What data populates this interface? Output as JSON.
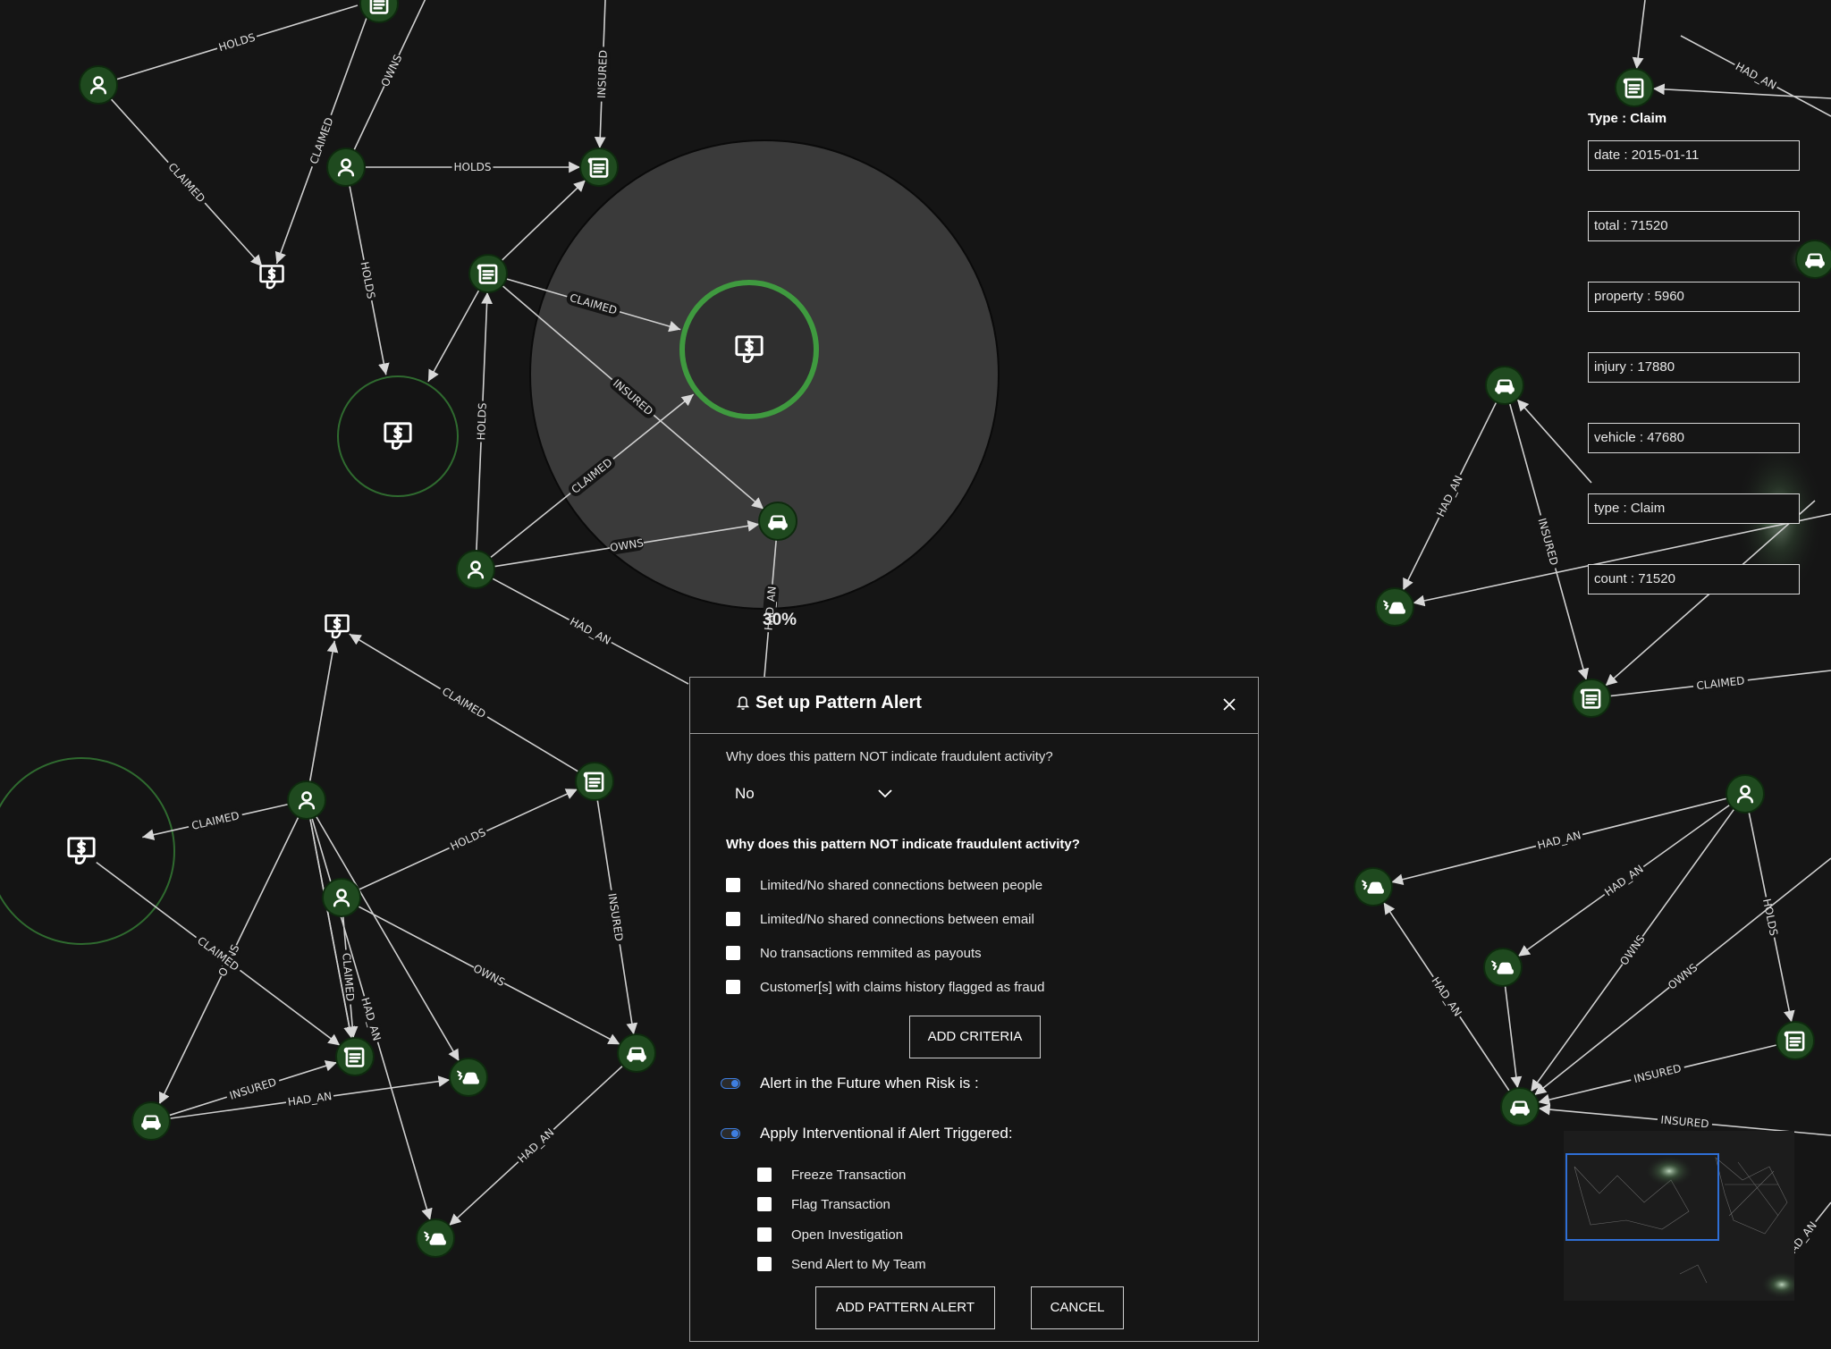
{
  "graph": {
    "edge_labels": [
      "HOLDS",
      "OWNS",
      "INSURED",
      "CLAIMED",
      "HOLDS",
      "CLAIMED",
      "HOLDS",
      "CLAIMED",
      "CLAIMED",
      "INSURED",
      "CLAIMED",
      "OWNS",
      "HAD_AN",
      "HAD_AN",
      "CLAIMED",
      "CLAIMED",
      "CLAIMED",
      "HOLDS",
      "INSURED",
      "HOLDS",
      "HAD_AN",
      "OWNS",
      "OWNS",
      "CLAIMED",
      "HAD_AN",
      "INSURED",
      "HAD_AN",
      "HAD_AN",
      "INSURED",
      "HAD_AN",
      "HAD_AN",
      "CLAIMED",
      "HAD_AN",
      "OWNS",
      "HOLDS",
      "HAD_AN",
      "HAD_AN",
      "OWNS",
      "INSURED",
      "INSURED",
      "HAD_AN"
    ],
    "progress_label": "30%"
  },
  "properties": {
    "heading": "Type : Claim",
    "fields": [
      "date : 2015-01-11",
      "total : 71520",
      "property : 5960",
      "injury : 17880",
      "vehicle : 47680",
      "type : Claim",
      "count : 71520"
    ]
  },
  "dialog": {
    "title": "Set up Pattern Alert",
    "question1": "Why does this pattern NOT indicate fraudulent activity?",
    "select_value": "No",
    "question2": "Why does this pattern NOT indicate fraudulent activity?",
    "criteria": [
      "Limited/No shared connections between people",
      "Limited/No shared connections between email",
      "No transactions remmited as payouts",
      "Customer[s] with claims history flagged as fraud"
    ],
    "add_criteria_label": "ADD CRITERIA",
    "toggle1_label": "Alert in the Future when Risk is :",
    "toggle2_label": "Apply Interventional if Alert Triggered:",
    "interventions": [
      "Freeze Transaction",
      "Flag Transaction",
      "Open Investigation",
      "Send Alert to My Team"
    ],
    "add_pattern_label": "ADD PATTERN ALERT",
    "cancel_label": "CANCEL"
  },
  "colors": {
    "background": "#151515",
    "node_fill": "#1f4a1f",
    "highlight_ring": "#3f9a3f",
    "toggle_accent": "#3e7ee0",
    "minimap_view": "#2f6fd6"
  }
}
